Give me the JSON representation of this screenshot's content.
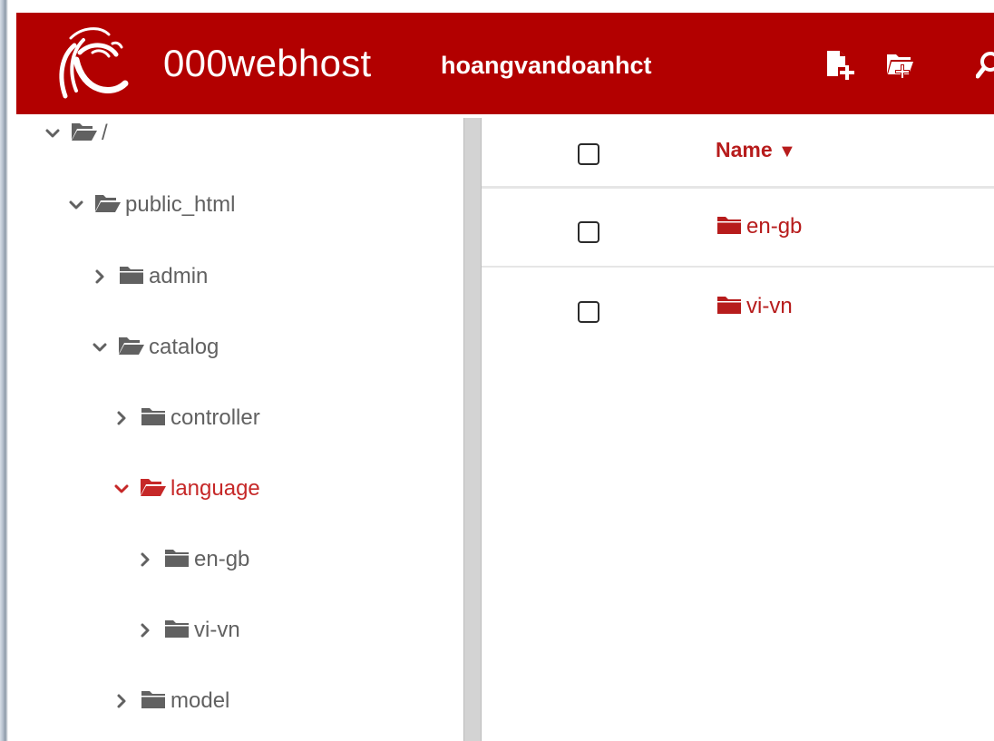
{
  "header": {
    "brand": "000webhost",
    "username": "hoangvandoanhct",
    "colors": {
      "bar": "#b20000",
      "text": "#ffffff"
    },
    "icons": [
      "logo-icon",
      "new-file-icon",
      "new-folder-icon",
      "search-icon"
    ]
  },
  "tree": {
    "nodes": [
      {
        "label": "/",
        "state": "expanded",
        "icon": "folder-open-icon"
      },
      {
        "label": "public_html",
        "state": "expanded",
        "icon": "folder-open-icon"
      },
      {
        "label": "admin",
        "state": "collapsed",
        "icon": "folder-icon"
      },
      {
        "label": "catalog",
        "state": "expanded",
        "icon": "folder-open-icon"
      },
      {
        "label": "controller",
        "state": "collapsed",
        "icon": "folder-icon"
      },
      {
        "label": "language",
        "state": "expanded",
        "icon": "folder-open-icon",
        "active": true
      },
      {
        "label": "en-gb",
        "state": "collapsed",
        "icon": "folder-icon"
      },
      {
        "label": "vi-vn",
        "state": "collapsed",
        "icon": "folder-icon"
      },
      {
        "label": "model",
        "state": "collapsed",
        "icon": "folder-icon"
      }
    ],
    "colors": {
      "text": "#616161",
      "active": "#c62828"
    }
  },
  "files": {
    "columns": [
      {
        "label": "Name",
        "sort": "▼"
      }
    ],
    "rows": [
      {
        "name": "en-gb",
        "type": "folder",
        "checked": false
      },
      {
        "name": "vi-vn",
        "type": "folder",
        "checked": false
      }
    ],
    "colors": {
      "accent": "#b71c1c"
    }
  }
}
